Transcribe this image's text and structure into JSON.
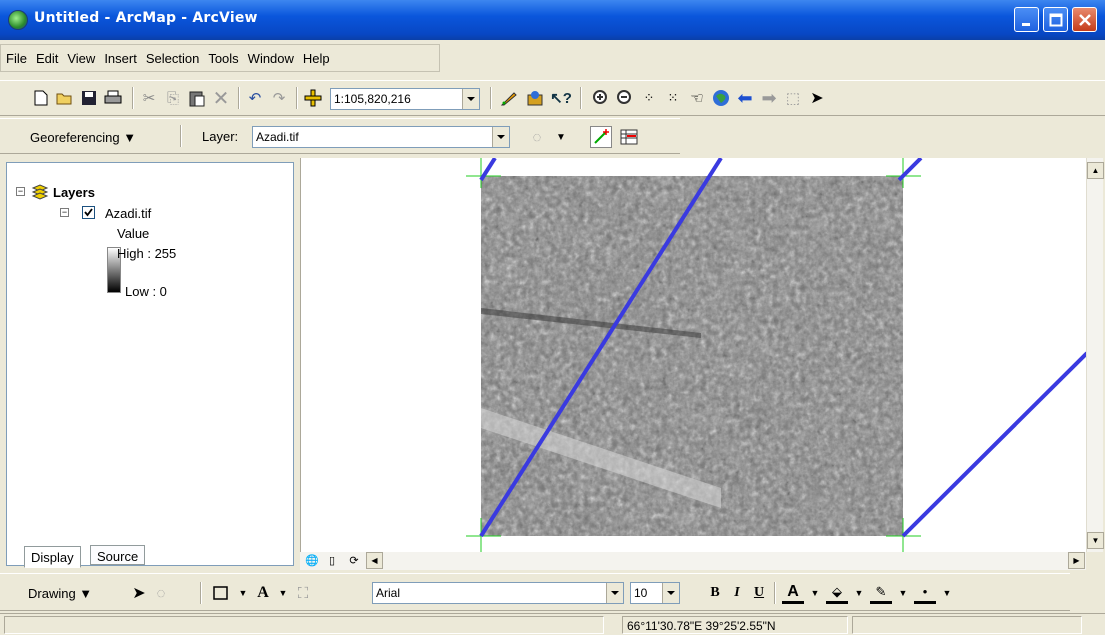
{
  "window": {
    "title": "Untitled - ArcMap - ArcView"
  },
  "menu": [
    "File",
    "Edit",
    "View",
    "Insert",
    "Selection",
    "Tools",
    "Window",
    "Help"
  ],
  "standard_toolbar": {
    "scale": "1:105,820,216"
  },
  "georef_toolbar": {
    "menu_label": "Georeferencing ▼",
    "layer_label": "Layer:",
    "layer_value": "Azadi.tif"
  },
  "toc": {
    "root": "Layers",
    "layer": "Azadi.tif",
    "value_label": "Value",
    "high": "High : 255",
    "low": "Low : 0",
    "tabs": [
      "Display",
      "Source"
    ]
  },
  "drawing_toolbar": {
    "menu_label": "Drawing ▼",
    "font": "Arial",
    "size": "10",
    "bold": "B",
    "italic": "I",
    "underline": "U",
    "font_color": "A"
  },
  "status": {
    "coords": "66°11'30.78\"E 39°25'2.55\"N"
  },
  "colors": {
    "title_bar": "#0a56dc",
    "grid_line": "#3a3ae0",
    "neatline": "#22cc22"
  }
}
